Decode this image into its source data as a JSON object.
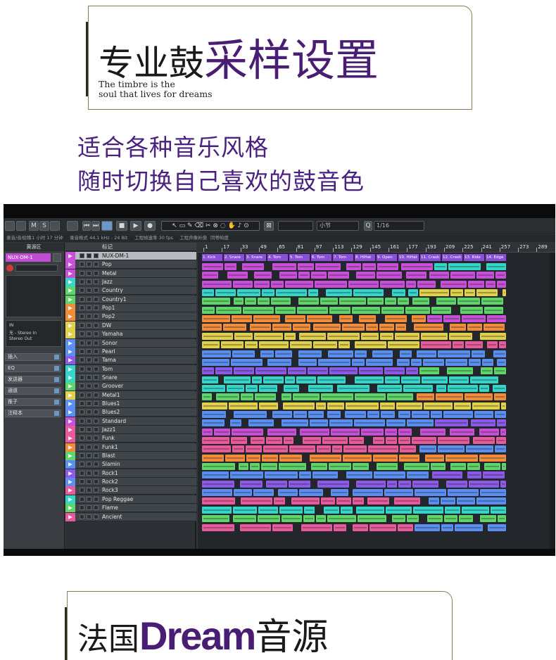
{
  "top_card": {
    "title_black": "专业鼓",
    "title_purple": "采样设置",
    "subtitle_line1": "The timbre is the",
    "subtitle_line2": "soul that lives for dreams"
  },
  "taglines": [
    "适合各种音乐风格",
    "随时切换自己喜欢的鼓音色"
  ],
  "bottom_card": {
    "title_black": "法国",
    "title_purple": "Dream",
    "title_black2": "音源"
  },
  "colors": {
    "purple_text": "#4a1d74",
    "tagline": "#4a2180",
    "clip_colors": [
      "#c84fd8",
      "#e85a9c",
      "#5fd46a",
      "#33d6c8",
      "#5a8ef0",
      "#f08c3a",
      "#e0d04a",
      "#8c5ae8"
    ]
  },
  "daw": {
    "toolbar_fields": {
      "snap": "小节",
      "quantize": "1/16"
    },
    "info": [
      "录音/音视频",
      "11 小时 17 分钟",
      "录音格式 44.1 kHz - 24 Bit",
      "工程帧速率 30 fps",
      "工程声像补偿",
      "同等响度"
    ],
    "inspector": {
      "title": "黄源区",
      "track_name": "NUX-DM-1",
      "routing_in": "无 - Stereo In",
      "routing_out": "Stereo Out",
      "sections": [
        "插入",
        "EQ",
        "发送器",
        "通道",
        "推子",
        "注释本"
      ]
    },
    "tracklist_header": "标记",
    "tracks": [
      "NUX-DM-1",
      "Pop",
      "Metal",
      "Jazz",
      "Country",
      "Country1",
      "Pop1",
      "Pop2",
      "DW",
      "Yamaha",
      "Sonor",
      "Pearl",
      "Tama",
      "Tom",
      "Snare",
      "Groover",
      "Metal1",
      "Blues1",
      "Blues2",
      "Standard",
      "Jazz1",
      "Funk",
      "Funk1",
      "Blast",
      "Slamin",
      "Rock1",
      "Rock2",
      "Rock3",
      "Pop Reggae",
      "Flame",
      "Ancient"
    ],
    "ruler": [
      "1",
      "17",
      "33",
      "49",
      "65",
      "81",
      "97",
      "113",
      "129",
      "145",
      "161",
      "177",
      "193",
      "209",
      "225",
      "241",
      "257",
      "273",
      "289"
    ],
    "marker_labels": [
      "1. Kick",
      "2. Snare",
      "3. Snare",
      "4. Tom",
      "5. Tom",
      "6. Tom",
      "7. Tom",
      "8. HiHat",
      "9. Open",
      "10. HiHat",
      "11. Crash",
      "12. Crash",
      "13. Ride",
      "14. Edge"
    ]
  }
}
